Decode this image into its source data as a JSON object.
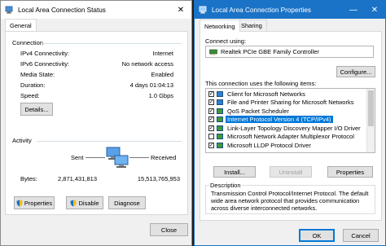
{
  "status_window": {
    "title": "Local Area Connection Status",
    "close_glyph": "✕",
    "tab": "General",
    "connection": {
      "heading": "Connection",
      "rows": [
        {
          "label": "IPv4 Connectivity:",
          "value": "Internet"
        },
        {
          "label": "IPv6 Connectivity:",
          "value": "No network access"
        },
        {
          "label": "Media State:",
          "value": "Enabled"
        },
        {
          "label": "Duration:",
          "value": "4 days 01:04:13"
        },
        {
          "label": "Speed:",
          "value": "1.0 Gbps"
        }
      ],
      "details_button": "Details..."
    },
    "activity": {
      "heading": "Activity",
      "sent_label": "Sent",
      "received_label": "Received",
      "bytes_label": "Bytes:",
      "bytes_sent": "2,871,431,813",
      "bytes_received": "15,513,765,953"
    },
    "buttons": {
      "properties": "Properties",
      "disable": "Disable",
      "diagnose": "Diagnose",
      "close": "Close"
    }
  },
  "props_window": {
    "title": "Local Area Connection Properties",
    "minimize_glyph": "—",
    "close_glyph": "✕",
    "tabs": [
      "Networking",
      "Sharing"
    ],
    "connect_using_label": "Connect using:",
    "adapter": "Realtek PCIe GBE Family Controller",
    "configure_button": "Configure...",
    "items_label": "This connection uses the following items:",
    "items": [
      {
        "label": "Client for Microsoft Networks",
        "checked": true,
        "selected": false
      },
      {
        "label": "File and Printer Sharing for Microsoft Networks",
        "checked": true,
        "selected": false
      },
      {
        "label": "QoS Packet Scheduler",
        "checked": true,
        "selected": false
      },
      {
        "label": "Internet Protocol Version 4 (TCP/IPv4)",
        "checked": true,
        "selected": true
      },
      {
        "label": "Link-Layer Topology Discovery Mapper I/O Driver",
        "checked": true,
        "selected": false
      },
      {
        "label": "Microsoft Network Adapter Multiplexor Protocol",
        "checked": false,
        "selected": false
      },
      {
        "label": "Microsoft LLDP Protocol Driver",
        "checked": true,
        "selected": false
      }
    ],
    "buttons": {
      "install": "Install...",
      "uninstall": "Uninstall",
      "properties": "Properties",
      "ok": "OK",
      "cancel": "Cancel"
    },
    "description": {
      "heading": "Description",
      "text": "Transmission Control Protocol/Internet Protocol. The default wide area network protocol that provides communication across diverse interconnected networks."
    }
  },
  "colors": {
    "selection": "#0078d7",
    "window_bg": "#f0f0f0",
    "border": "#adadad"
  }
}
